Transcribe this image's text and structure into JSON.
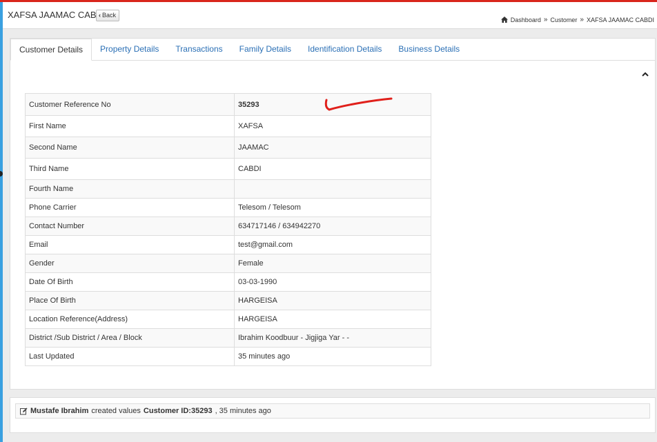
{
  "header": {
    "title": "XAFSA JAAMAC CABDI",
    "back_label": "Back",
    "breadcrumb": [
      "Dashboard",
      "Customer",
      "XAFSA JAAMAC CABDI"
    ],
    "breadcrumb_sep": "»"
  },
  "tabs": [
    {
      "label": "Customer Details",
      "active": true
    },
    {
      "label": "Property Details",
      "active": false
    },
    {
      "label": "Transactions",
      "active": false
    },
    {
      "label": "Family Details",
      "active": false
    },
    {
      "label": "Identification Details",
      "active": false
    },
    {
      "label": "Business Details",
      "active": false
    }
  ],
  "details": [
    {
      "label": "Customer Reference No",
      "value": "35293"
    },
    {
      "label": "First Name",
      "value": "XAFSA"
    },
    {
      "label": "Second Name",
      "value": "JAAMAC"
    },
    {
      "label": "Third Name",
      "value": "CABDI"
    },
    {
      "label": "Fourth Name",
      "value": ""
    },
    {
      "label": "Phone Carrier",
      "value": "Telesom / Telesom"
    },
    {
      "label": "Contact Number",
      "value": "634717146 / 634942270"
    },
    {
      "label": "Email",
      "value": "test@gmail.com"
    },
    {
      "label": "Gender",
      "value": "Female"
    },
    {
      "label": "Date Of Birth",
      "value": "03-03-1990"
    },
    {
      "label": "Place Of Birth",
      "value": "HARGEISA"
    },
    {
      "label": "Location Reference(Address)",
      "value": "HARGEISA"
    },
    {
      "label": "District /Sub District / Area / Block",
      "value": "Ibrahim Koodbuur - Jigjiga Yar - -"
    },
    {
      "label": "Last Updated",
      "value": "35 minutes ago"
    }
  ],
  "log": {
    "user": "Mustafe Ibrahim",
    "action": "created values",
    "target": "Customer ID:35293",
    "time": ", 35 minutes ago"
  },
  "colors": {
    "accent_link": "#2a6fb5",
    "top_bar": "#d9261c",
    "left_bar": "#3aa0e0",
    "annotation": "#e0201b"
  }
}
